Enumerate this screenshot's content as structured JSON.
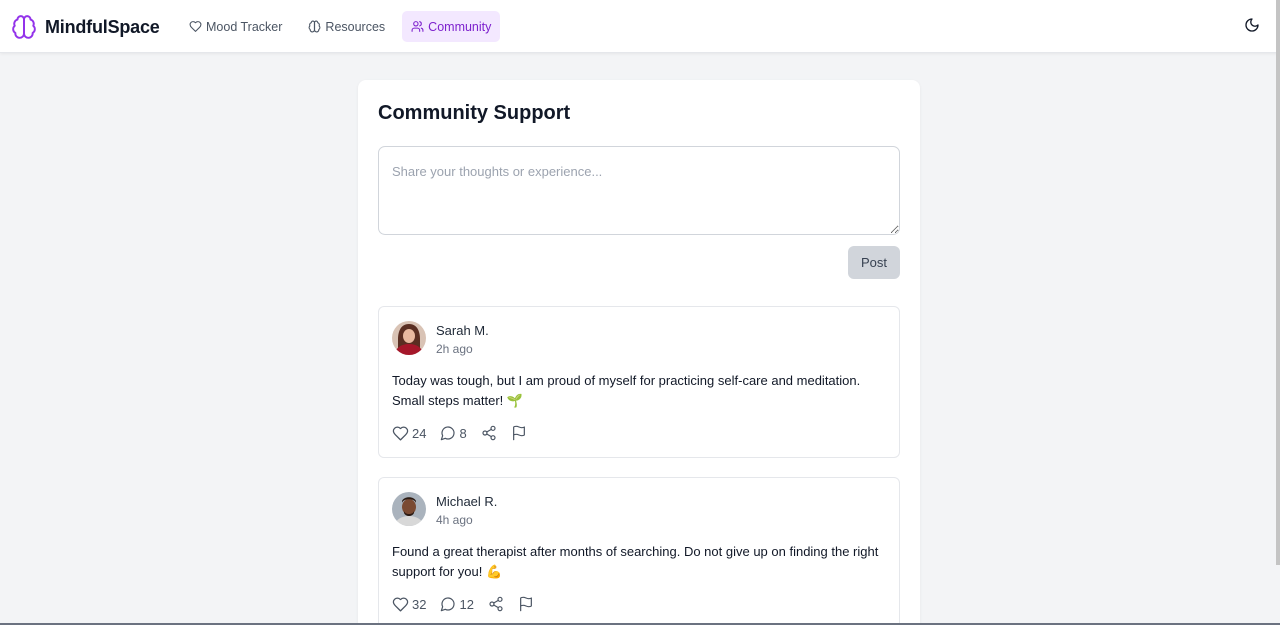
{
  "app": {
    "name": "MindfulSpace"
  },
  "nav": {
    "items": [
      {
        "label": "Mood Tracker",
        "icon": "heart-icon",
        "active": false
      },
      {
        "label": "Resources",
        "icon": "brain-icon",
        "active": false
      },
      {
        "label": "Community",
        "icon": "users-icon",
        "active": true
      }
    ]
  },
  "theme_toggle": {
    "icon": "moon-icon"
  },
  "page": {
    "title": "Community Support"
  },
  "composer": {
    "placeholder": "Share your thoughts or experience...",
    "value": ""
  },
  "post_button": {
    "label": "Post"
  },
  "posts": [
    {
      "author": "Sarah M.",
      "time": "2h ago",
      "text": "Today was tough, but I am proud of myself for practicing self-care and meditation. Small steps matter! 🌱",
      "likes": "24",
      "comments": "8"
    },
    {
      "author": "Michael R.",
      "time": "4h ago",
      "text": "Found a great therapist after months of searching. Do not give up on finding the right support for you! 💪",
      "likes": "32",
      "comments": "12"
    }
  ],
  "colors": {
    "accent": "#7e22ce",
    "accent_bg": "#f3e8ff",
    "page_bg": "#f3f4f6",
    "post_button_bg": "#d1d5db"
  }
}
